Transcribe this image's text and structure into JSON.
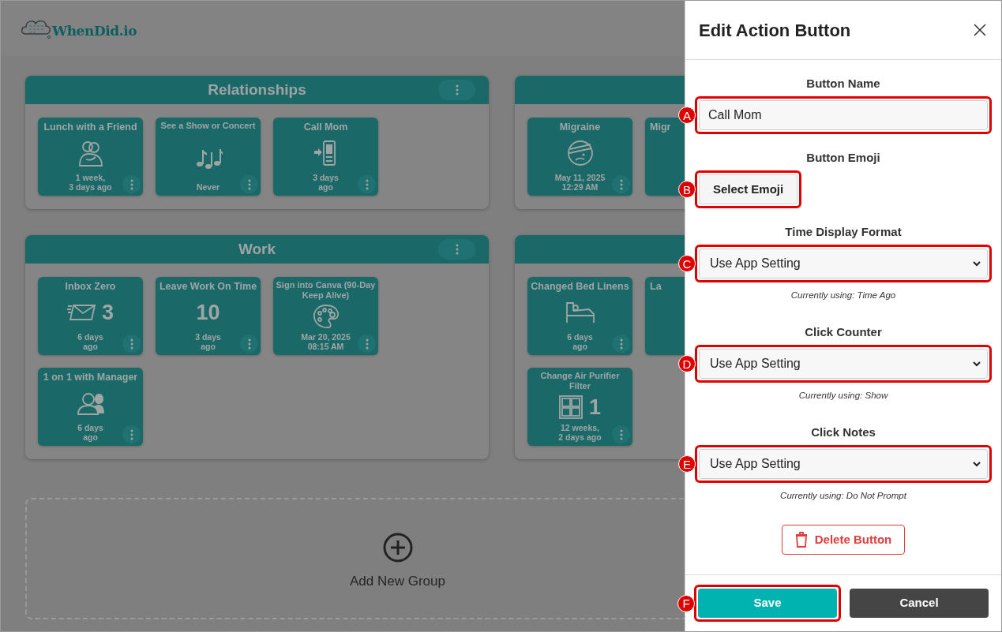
{
  "app": {
    "logo": "WhenDid.io"
  },
  "groups": [
    {
      "title": "Relationships",
      "tiles": [
        {
          "title": "Lunch with a Friend",
          "time": [
            "1 week,",
            "3 days ago"
          ]
        },
        {
          "title": "See a Show or Concert",
          "time": [
            "Never"
          ]
        },
        {
          "title": "Call Mom",
          "time": [
            "3 days",
            "ago"
          ]
        }
      ]
    },
    {
      "tiles": [
        {
          "title": "Migraine",
          "time": [
            "May 11, 2025",
            "12:29 AM"
          ]
        },
        {
          "title": "Migr"
        }
      ]
    },
    {
      "title": "Work",
      "tiles": [
        {
          "title": "Inbox Zero",
          "count": "3",
          "time": [
            "6 days",
            "ago"
          ]
        },
        {
          "title": "Leave Work On Time",
          "count": "10",
          "time": [
            "3 days",
            "ago"
          ]
        },
        {
          "title": "Sign into Canva (90-Day Keep Alive)",
          "time": [
            "Mar 20, 2025",
            "08:15 AM"
          ]
        },
        {
          "title": "1 on 1 with Manager",
          "time": [
            "6 days",
            "ago"
          ]
        }
      ]
    },
    {
      "tiles": [
        {
          "title": "Changed Bed Linens",
          "time": [
            "6 days",
            "ago"
          ]
        },
        {
          "title": "La"
        },
        {
          "title": "Change Air Purifier Filter",
          "count": "1",
          "time": [
            "12 weeks,",
            "2 days ago"
          ]
        }
      ]
    }
  ],
  "add_group": {
    "label": "Add New Group"
  },
  "panel": {
    "title": "Edit Action Button",
    "fields": [
      {
        "label": "Button Name",
        "kind": "text",
        "value": "Call Mom",
        "callout": "A"
      },
      {
        "label": "Button Emoji",
        "kind": "button",
        "value": "Select Emoji",
        "callout": "B"
      },
      {
        "label": "Time Display Format",
        "kind": "select",
        "value": "Use App Setting",
        "hint": "Currently using: Time Ago",
        "callout": "C"
      },
      {
        "label": "Click Counter",
        "kind": "select",
        "value": "Use App Setting",
        "hint": "Currently using: Show",
        "callout": "D"
      },
      {
        "label": "Click Notes",
        "kind": "select",
        "value": "Use App Setting",
        "hint": "Currently using: Do Not Prompt",
        "callout": "E"
      }
    ],
    "delete_button": "Delete Button",
    "footer_buttons": [
      {
        "label": "Save",
        "kind": "primary",
        "callout": "F"
      },
      {
        "label": "Cancel",
        "kind": "secondary"
      }
    ]
  }
}
